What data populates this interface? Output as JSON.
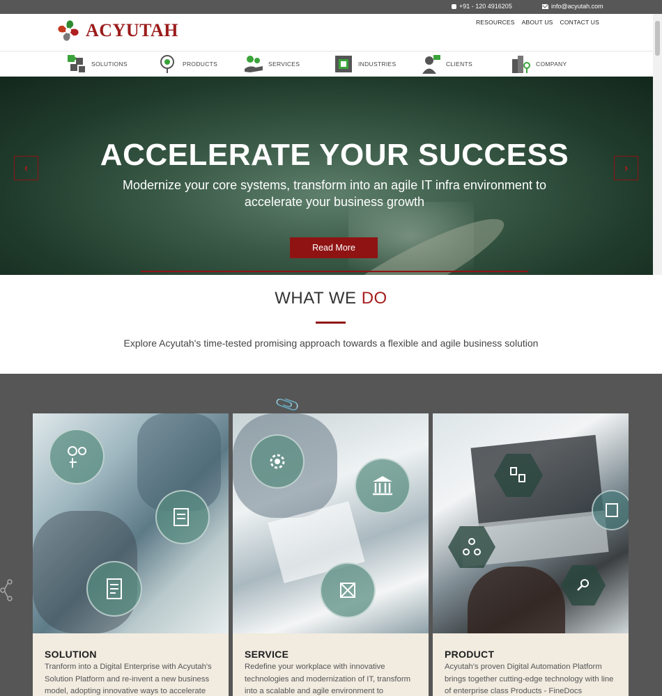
{
  "topbar": {
    "phone": "+91 - 120 4916205",
    "email": "info@acyutah.com"
  },
  "header": {
    "logo_text": "ACYUTAH",
    "links": [
      "RESOURCES",
      "ABOUT US",
      "CONTACT US"
    ]
  },
  "nav": {
    "items": [
      {
        "label": "SOLUTIONS",
        "icon": "puzzle-icon"
      },
      {
        "label": "PRODUCTS",
        "icon": "bulb-icon"
      },
      {
        "label": "SERVICES",
        "icon": "gear-hand-icon"
      },
      {
        "label": "INDUSTRIES",
        "icon": "circuit-icon"
      },
      {
        "label": "CLIENTS",
        "icon": "client-icon"
      },
      {
        "label": "COMPANY",
        "icon": "building-pin-icon"
      }
    ]
  },
  "hero": {
    "title": "ACCELERATE YOUR SUCCESS",
    "subtitle": "Modernize your core systems, transform into an agile IT infra environment to accelerate your business growth",
    "button": "Read More",
    "prev_arrow": "‹",
    "next_arrow": "›"
  },
  "what_we_do": {
    "title_part1": "WHAT WE ",
    "title_part2": "DO",
    "description": "Explore Acyutah's time-tested promising approach towards a flexible and agile business solution"
  },
  "cards": [
    {
      "title": "SOLUTION",
      "text": "Tranform into a Digital Enterprise with Acyutah's Solution Platform and re-invent a new business model, adopting innovative ways to accelerate"
    },
    {
      "title": "SERVICE",
      "text": "Redefine your workplace with innovative technologies and modernization of IT, transform into a scalable and agile environment to"
    },
    {
      "title": "PRODUCT",
      "text": "Acyutah's proven Digital Automation Platform brings together cutting-edge technology with line of enterprise class Products - FineDocs"
    }
  ],
  "colors": {
    "brand_red": "#8f1313",
    "topbar": "#575757",
    "dark_section": "#565656",
    "card_bg": "#f1ebe0"
  }
}
